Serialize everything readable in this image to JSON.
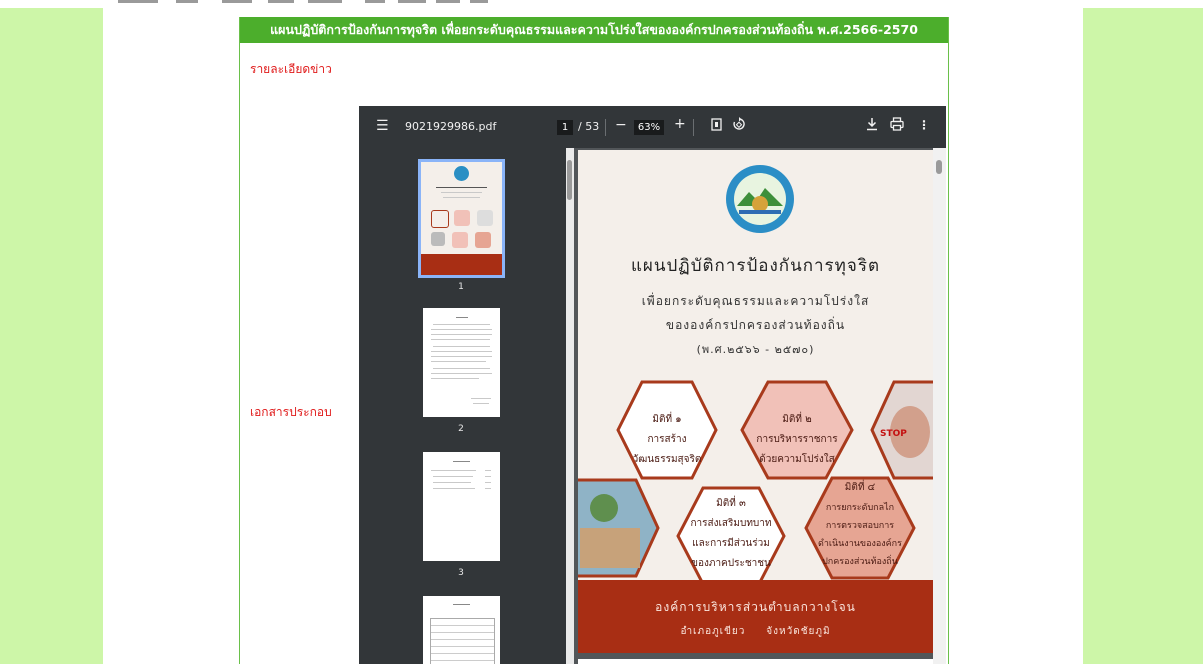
{
  "panel": {
    "title": "แผนปฏิบัติการป้องกันการทุจริต เพื่อยกระดับคุณธรรมและความโปร่งใสขององค์กรปกครองส่วนท้องถิ่น พ.ศ.2566-2570",
    "label_news_detail": "รายละเอียดข่าว",
    "label_attachment": "เอกสารประกอบ"
  },
  "pdf_viewer": {
    "filename": "9021929986.pdf",
    "current_page": "1",
    "page_total": "/ 53",
    "zoom": "63%",
    "icons": [
      "menu-icon",
      "zoom-out-icon",
      "zoom-in-icon",
      "fit-page-icon",
      "rotate-icon",
      "download-icon",
      "print-icon",
      "more-icon"
    ],
    "thumbnail_numbers": [
      "1",
      "2",
      "3"
    ]
  },
  "document": {
    "title": "แผนปฏิบัติการป้องกันการทุจริต",
    "subtitle_1": "เพื่อยกระดับคุณธรรมและความโปร่งใส",
    "subtitle_2": "ขององค์กรปกครองส่วนท้องถิ่น",
    "years": "(พ.ศ.๒๕๖๖ - ๒๕๗๐)",
    "dimensions": [
      {
        "title": "มิติที่ ๑",
        "line1": "การสร้าง",
        "line2": "วัฒนธรรมสุจริต"
      },
      {
        "title": "มิติที่ ๒",
        "line1": "การบริหารราชการ",
        "line2": "ด้วยความโปร่งใส"
      },
      {
        "title": "มิติที่ ๓",
        "line1": "การส่งเสริมบทบาท",
        "line2": "และการมีส่วนร่วม",
        "line3": "ของภาคประชาชน"
      },
      {
        "title": "มิติที่ ๔",
        "line1": "การยกระดับกลไก",
        "line2": "การตรวจสอบการ",
        "line3": "ดำเนินงานขององค์กร",
        "line4": "ปกครองส่วนท้องถิ่น"
      }
    ],
    "org_name": "องค์การบริหารส่วนตำบลกวางโจน",
    "location": "อำเภอภูเขียว     จังหวัดชัยภูมิ",
    "stop_sign_text": "STOP"
  },
  "colors": {
    "background_green": "#cdf6a8",
    "title_bar_green": "#4cae2c",
    "label_red": "#e01b1b",
    "viewer_dark": "#323639",
    "doc_footer_red": "#a82e14",
    "hex_border": "#a83a1c"
  }
}
